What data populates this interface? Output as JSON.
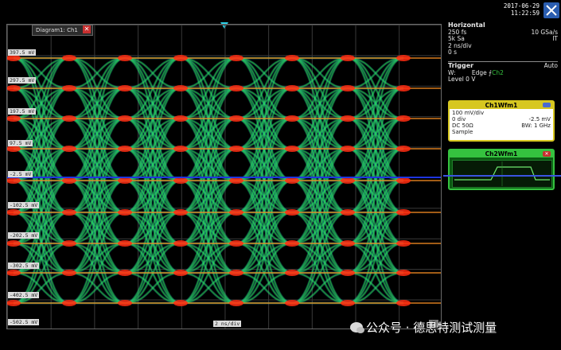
{
  "header": {
    "date": "2017-06-29",
    "time": "11:22:59",
    "logo_icon": "rs-logo-icon"
  },
  "diagram": {
    "tab_label": "Diagram1: Ch1",
    "close_icon": "close-icon",
    "x_scale": "2 ns/div",
    "y_labels": [
      "397.5 mV",
      "297.5 mV",
      "197.5 mV",
      "97.5 mV",
      "-2.5 mV",
      "-102.5 mV",
      "-202.5 mV",
      "-302.5 mV",
      "-402.5 mV",
      "-502.5 mV"
    ],
    "trigger_marker_icon": "trigger-position-icon",
    "colors": {
      "eye_green": "#2de03a",
      "eye_yellow": "#e3e832",
      "eye_red": "#ff2b10",
      "eye_blue": "#1fb6d8",
      "trace": "#1f35e0"
    }
  },
  "horizontal": {
    "title": "Horizontal",
    "time_res": "250 fs",
    "sample_rate": "10 GSa/s",
    "record_label": "5k Sa",
    "acq_indicator": "IT",
    "time_scale": "2 ns/div",
    "position": "0 s"
  },
  "trigger": {
    "title": "Trigger",
    "mode": "Auto",
    "source_label": "W:",
    "type": "Edge",
    "channel": "Ch2",
    "level": "Level 0 V"
  },
  "ch1": {
    "title": "Ch1Wfm1",
    "vscale": "100 mV/div",
    "pos": "0 div",
    "offset": "-2.5 mV",
    "coupling": "DC 50Ω",
    "bw": "BW: 1 GHz",
    "mode": "Sample"
  },
  "ch2": {
    "title": "Ch2Wfm1",
    "close_icon": "close-icon"
  },
  "footer": {
    "wechat_icon": "wechat-icon",
    "text": "公众号 · 德思特测试测量"
  }
}
